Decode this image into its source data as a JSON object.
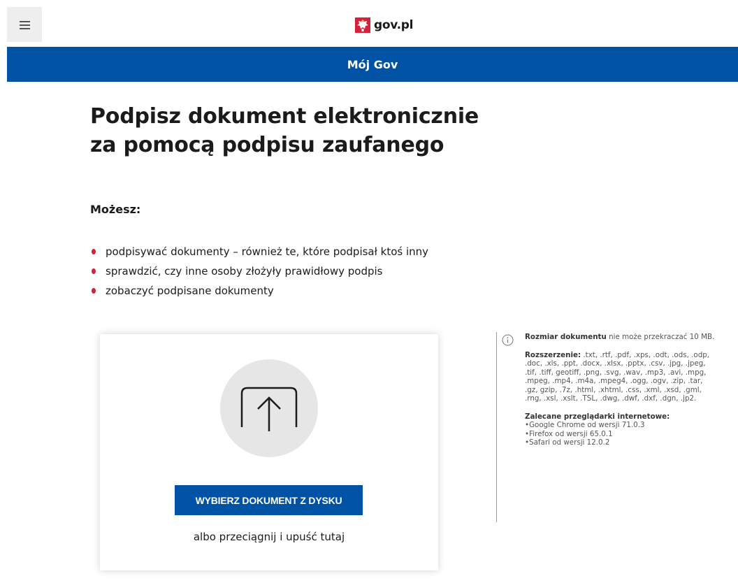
{
  "header": {
    "menu_icon": "hamburger-menu-icon",
    "logo_text": "gov.pl",
    "logo_icon": "polish-eagle-emblem-icon"
  },
  "bluebar": {
    "label": "Mój Gov"
  },
  "main": {
    "title_line1": "Podpisz dokument elektronicznie",
    "title_line2": "za pomocą podpisu zaufanego",
    "can_label": "Możesz:",
    "bullets": [
      "podpisywać dokumenty – również te, które podpisał ktoś inny",
      "sprawdzić, czy inne osoby złożyły prawidłowy podpis",
      "zobaczyć podpisane dokumenty"
    ]
  },
  "upload": {
    "icon": "upload-icon",
    "button_label": "WYBIERZ DOKUMENT Z DYSKU",
    "drop_text": "albo przeciągnij i upuść tutaj"
  },
  "info": {
    "icon": "info-icon",
    "size_bold": "Rozmiar dokumentu",
    "size_rest": " nie może przekraczać 10 MB.",
    "ext_bold": "Rozszerzenie:",
    "ext_list": " .txt, .rtf, .pdf, .xps, .odt, .ods, .odp, .doc, .xls, .ppt, .docx, .xlsx, .pptx, .csv, .jpg, .jpeg, .tif, .tiff, geotiff, .png, .svg, .wav, .mp3, .avi, .mpg, .mpeg, .mp4, .m4a, .mpeg4, .ogg, .ogv, .zip, .tar, .gz, gzip, .7z, .html, .xhtml, .css, .xml, .xsd, .gml, .rng, .xsl, .xslt, .TSL, .dwg, .dwf, .dxf, .dgn, .jp2.",
    "browsers_title": "Zalecane przeglądarki internetowe:",
    "browsers": [
      "Google Chrome od wersji 71.0.3",
      "Firefox od wersji 65.0.1",
      "Safari od wersji 12.0.2"
    ]
  },
  "colors": {
    "primary_blue": "#0052a5",
    "bullet_red": "#d4213d",
    "circle_gray": "#e6e6e6"
  }
}
